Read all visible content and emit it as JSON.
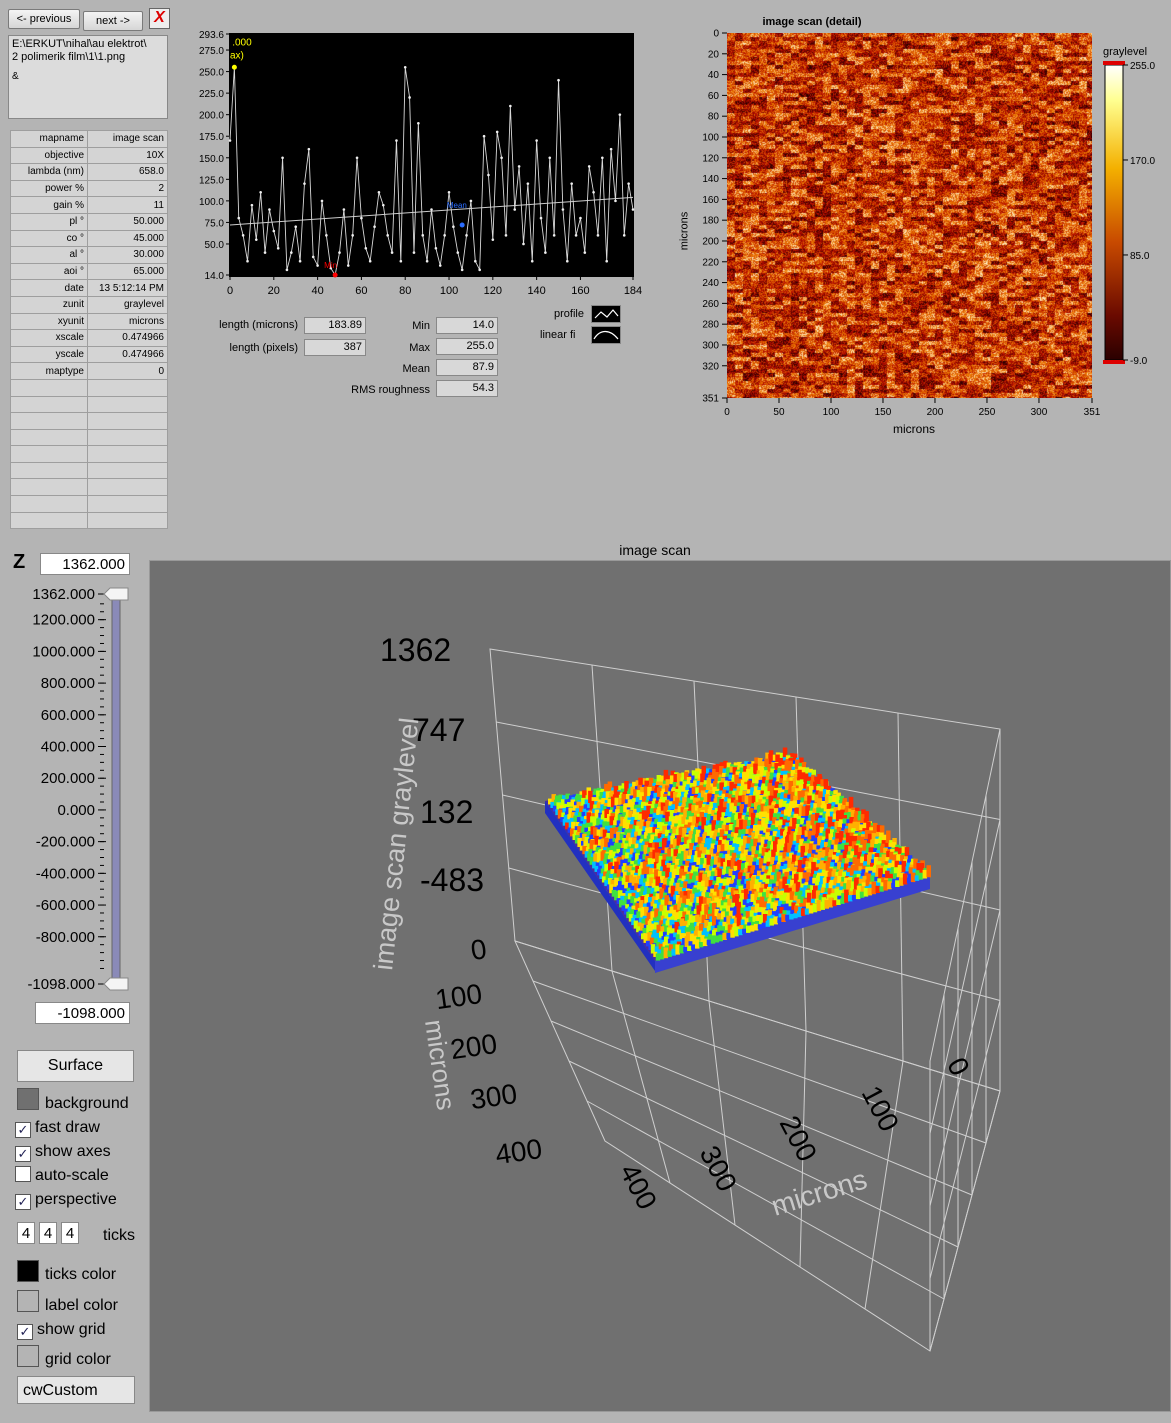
{
  "nav": {
    "previous_label": "<- previous",
    "next_label": "next ->",
    "close_label": "X"
  },
  "path_box": {
    "line1": "E:\\ERKUT\\nihal\\au elektrot\\",
    "line2": "2 polimerik film\\1\\1.png",
    "marker": "&"
  },
  "metadata": [
    {
      "key": "mapname",
      "value": "image scan"
    },
    {
      "key": "objective",
      "value": "10X"
    },
    {
      "key": "lambda (nm)",
      "value": "658.0"
    },
    {
      "key": "power %",
      "value": "2"
    },
    {
      "key": "gain %",
      "value": "11"
    },
    {
      "key": "pl °",
      "value": "50.000"
    },
    {
      "key": "co °",
      "value": "45.000"
    },
    {
      "key": "al °",
      "value": "30.000"
    },
    {
      "key": "aoi °",
      "value": "65.000"
    },
    {
      "key": "date",
      "value": "13 5:12:14 PM"
    },
    {
      "key": "zunit",
      "value": "graylevel"
    },
    {
      "key": "xyunit",
      "value": "microns"
    },
    {
      "key": "xscale",
      "value": "0.474966"
    },
    {
      "key": "yscale",
      "value": "0.474966"
    },
    {
      "key": "maptype",
      "value": "0"
    }
  ],
  "profile": {
    "y_ticks": [
      "293.6",
      "275.0",
      "250.0",
      "225.0",
      "200.0",
      "175.0",
      "150.0",
      "125.0",
      "100.0",
      "75.0",
      "50.0",
      "14.0"
    ],
    "x_ticks": [
      "0",
      "20",
      "40",
      "60",
      "80",
      "100",
      "120",
      "140",
      "160",
      "184"
    ],
    "max_marker": ".000",
    "max_marker_sub": "ax)",
    "min_marker": "Min",
    "mean_marker": "Mean",
    "length_microns_label": "length (microns)",
    "length_microns": "183.89",
    "length_pixels_label": "length (pixels)",
    "length_pixels": "387",
    "min_label": "Min",
    "min": "14.0",
    "max_label": "Max",
    "max": "255.0",
    "mean_label": "Mean",
    "mean": "87.9",
    "rms_label": "RMS roughness",
    "rms": "54.3",
    "legend_profile": "profile",
    "legend_linear": "linear fi"
  },
  "chart_data": {
    "type": "line",
    "x": [
      0,
      2,
      4,
      6,
      8,
      10,
      12,
      14,
      16,
      18,
      20,
      22,
      24,
      26,
      28,
      30,
      32,
      34,
      36,
      38,
      40,
      42,
      44,
      46,
      48,
      50,
      52,
      54,
      56,
      58,
      60,
      62,
      64,
      66,
      68,
      70,
      72,
      74,
      76,
      78,
      80,
      82,
      84,
      86,
      88,
      90,
      92,
      94,
      96,
      98,
      100,
      102,
      104,
      106,
      108,
      110,
      112,
      114,
      116,
      118,
      120,
      122,
      124,
      126,
      128,
      130,
      132,
      134,
      136,
      138,
      140,
      142,
      144,
      146,
      148,
      150,
      152,
      154,
      156,
      158,
      160,
      162,
      164,
      166,
      168,
      170,
      172,
      174,
      176,
      178,
      180,
      182,
      184
    ],
    "values": [
      170,
      255,
      80,
      60,
      30,
      95,
      55,
      110,
      40,
      90,
      65,
      45,
      150,
      20,
      40,
      70,
      30,
      120,
      160,
      35,
      25,
      100,
      60,
      22,
      14,
      40,
      90,
      25,
      60,
      150,
      80,
      45,
      30,
      70,
      110,
      95,
      60,
      40,
      170,
      30,
      255,
      220,
      40,
      190,
      60,
      30,
      90,
      45,
      25,
      60,
      110,
      70,
      40,
      20,
      60,
      100,
      30,
      20,
      175,
      130,
      55,
      180,
      150,
      60,
      210,
      90,
      140,
      50,
      120,
      30,
      170,
      80,
      40,
      150,
      60,
      240,
      90,
      30,
      120,
      60,
      80,
      40,
      140,
      110,
      60,
      150,
      30,
      160,
      100,
      200,
      60,
      120,
      90
    ],
    "linear_fit": [
      72,
      104
    ],
    "ylim": [
      14.0,
      293.6
    ],
    "xlim": [
      0,
      184
    ]
  },
  "heatmap": {
    "title": "image scan (detail)",
    "ylabel": "microns",
    "xlabel": "microns",
    "y_ticks": [
      "0",
      "20",
      "40",
      "60",
      "80",
      "100",
      "120",
      "140",
      "160",
      "180",
      "200",
      "220",
      "240",
      "260",
      "280",
      "300",
      "320",
      "351"
    ],
    "x_ticks": [
      "0",
      "50",
      "100",
      "150",
      "200",
      "250",
      "300",
      "351"
    ],
    "colorbar_label": "graylevel",
    "colorbar_ticks": [
      "255.0",
      "170.0",
      "85.0",
      "-9.0"
    ]
  },
  "zcontrol": {
    "z_label": "Z",
    "z_top": "1362.000",
    "z_bottom": "-1098.000",
    "scale_ticks": [
      "1362.000",
      "1200.000",
      "1000.000",
      "800.000",
      "600.000",
      "400.000",
      "200.000",
      "0.000",
      "-200.000",
      "-400.000",
      "-600.000",
      "-800.000",
      "-1098.000"
    ]
  },
  "plot3d": {
    "title": "image scan",
    "z_ticks": [
      "1362",
      "747",
      "132",
      "-483"
    ],
    "y_ticks": [
      "0",
      "100",
      "200",
      "300",
      "400"
    ],
    "x_ticks": [
      "0",
      "100",
      "200",
      "300",
      "400"
    ],
    "z_label": "image scan graylevel",
    "y_label": "microns",
    "x_label": "microns"
  },
  "controls": {
    "surface_label": "Surface",
    "background_label": "background",
    "fast_draw_label": "fast draw",
    "fast_draw": true,
    "show_axes_label": "show axes",
    "show_axes": true,
    "auto_scale_label": "auto-scale",
    "auto_scale": false,
    "perspective_label": "perspective",
    "perspective": true,
    "ticks_values": [
      "4",
      "4",
      "4"
    ],
    "ticks_label": "ticks",
    "ticks_color_label": "ticks color",
    "label_color_label": "label color",
    "show_grid_label": "show grid",
    "show_grid": true,
    "grid_color_label": "grid color",
    "colormap_value": "cwCustom",
    "check_glyph": "✓"
  }
}
